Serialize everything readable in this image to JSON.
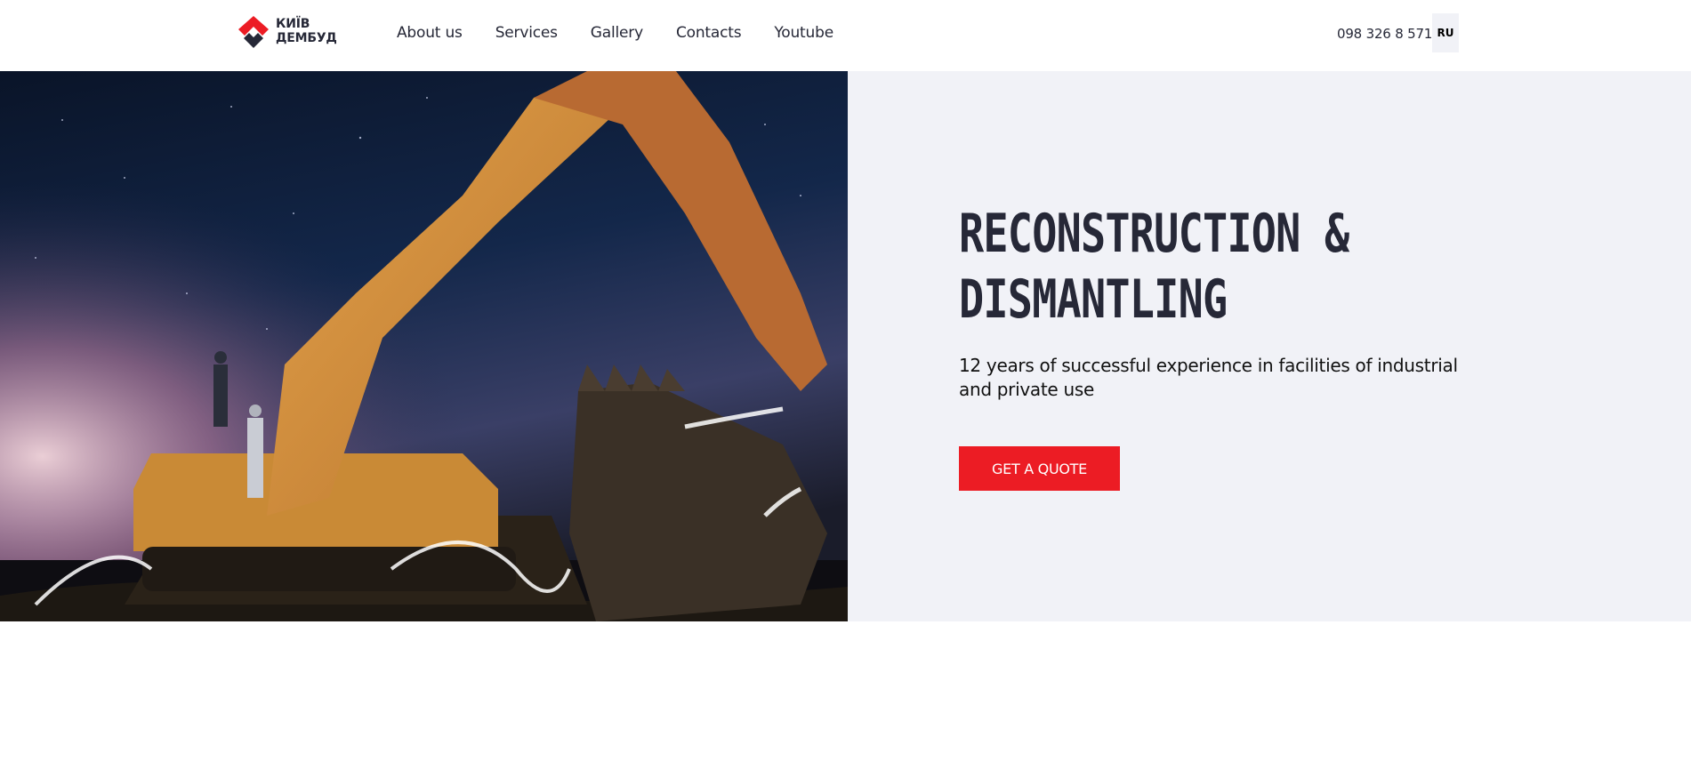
{
  "header": {
    "logo": {
      "line1": "КИЇВ",
      "line2": "ДЕМБУД"
    },
    "nav": [
      {
        "label": "About us"
      },
      {
        "label": "Services"
      },
      {
        "label": "Gallery"
      },
      {
        "label": "Contacts"
      },
      {
        "label": "Youtube"
      }
    ],
    "phone": "098 326 8 571",
    "lang": "RU"
  },
  "hero": {
    "title_line1": "RECONSTRUCTION &",
    "title_line2": "DISMANTLING",
    "subtitle": "12 years of successful experience in facilities of industrial and private use",
    "cta_label": "GET A QUOTE"
  },
  "colors": {
    "accent": "#ec1c24",
    "text": "#262837",
    "hero_bg": "#f1f2f7"
  }
}
